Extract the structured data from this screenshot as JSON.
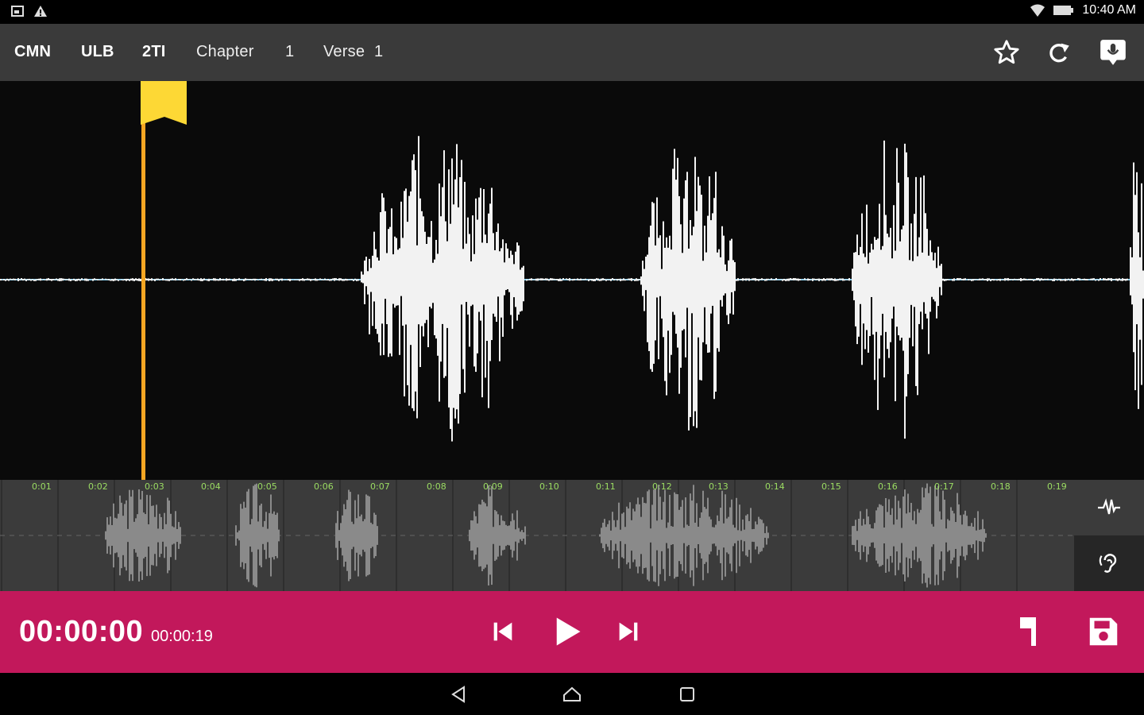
{
  "statusbar": {
    "time": "10:40 AM"
  },
  "toolbar": {
    "language": "CMN",
    "version": "ULB",
    "book": "2TI",
    "chapter_label": "Chapter",
    "chapter_number": "1",
    "verse_label": "Verse",
    "verse_number": "1",
    "icons": [
      "star-icon",
      "redo-icon",
      "insert-recording-icon"
    ]
  },
  "minimap": {
    "ticks": [
      "0:01",
      "0:02",
      "0:03",
      "0:04",
      "0:05",
      "0:06",
      "0:07",
      "0:08",
      "0:09",
      "0:10",
      "0:11",
      "0:12",
      "0:13",
      "0:14",
      "0:15",
      "0:16",
      "0:17",
      "0:18",
      "0:19"
    ]
  },
  "side_tools": {
    "icons": [
      "waveform-icon",
      "ear-icon"
    ]
  },
  "playback": {
    "current_time": "00:00:00",
    "total_time": "00:00:19",
    "icons": [
      "skip-previous-icon",
      "play-icon",
      "skip-next-icon",
      "verse-marker-icon",
      "save-icon"
    ]
  },
  "navbar": {
    "icons": [
      "back-icon",
      "home-icon",
      "recents-icon"
    ]
  },
  "colors": {
    "toolbar": "#3a3a3a",
    "playbar": "#c2185b",
    "marker": "#f5a623",
    "flag": "#fdd835",
    "baseline": "#7fc7e8",
    "tick_text": "#9bdc62"
  }
}
